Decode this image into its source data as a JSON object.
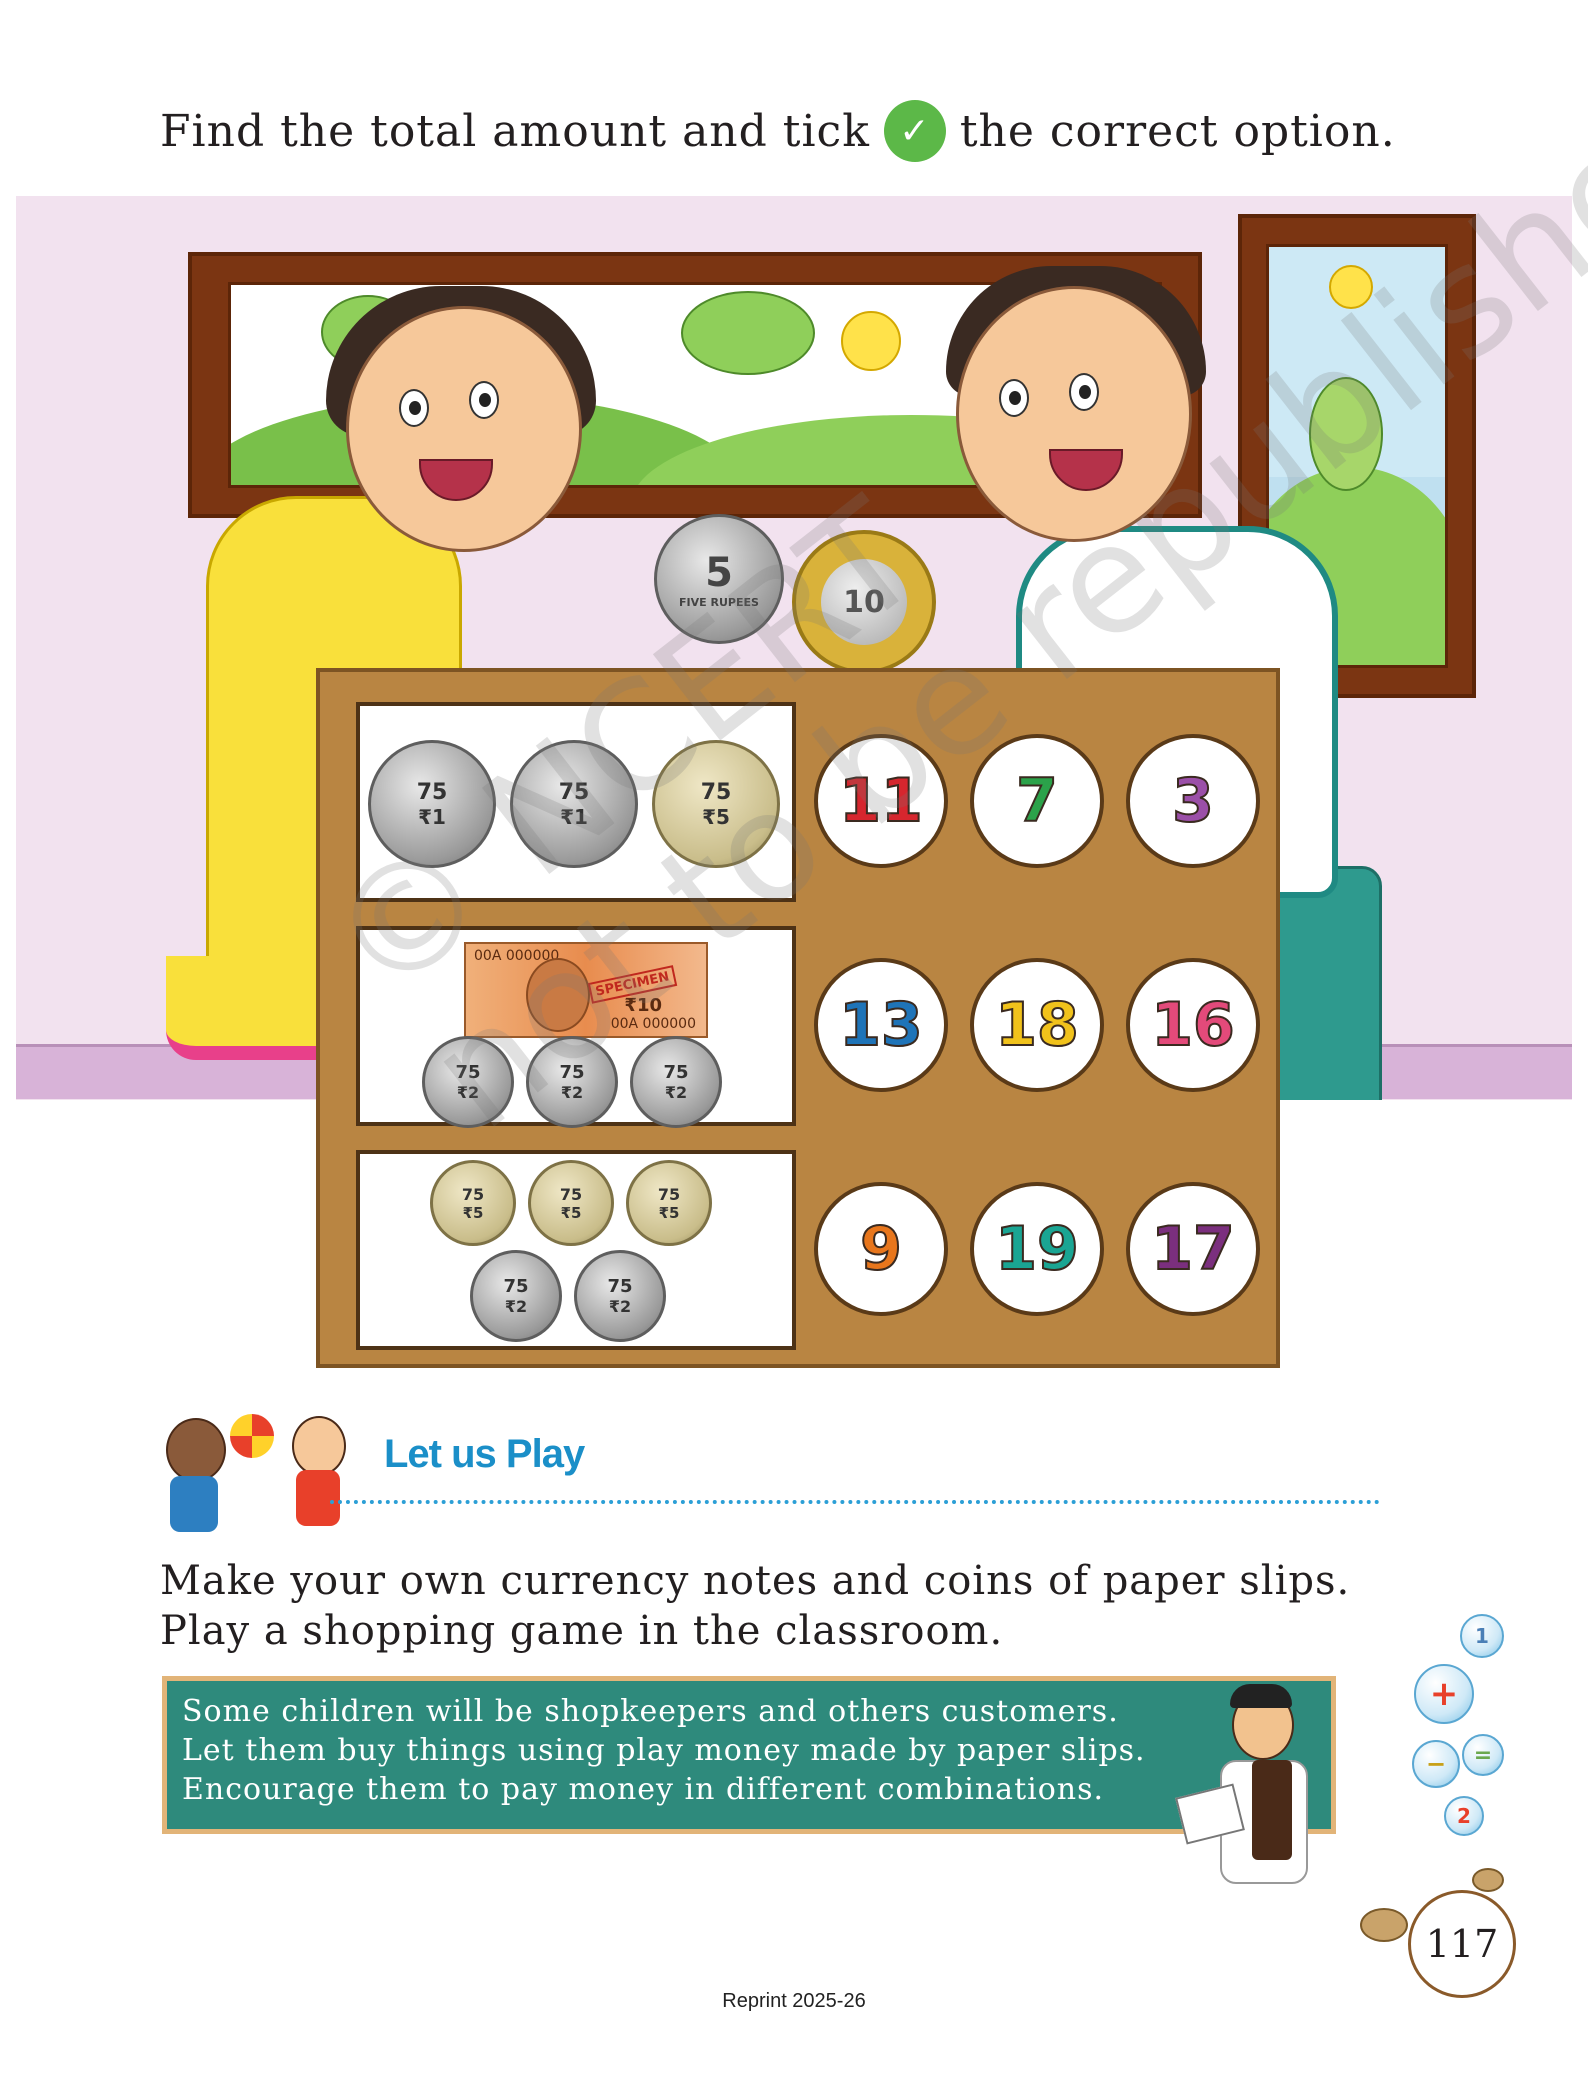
{
  "instruction": {
    "before": "Find the total amount and tick",
    "tick_glyph": "✓",
    "after": "the correct option."
  },
  "scene": {
    "held_coins": [
      {
        "label": "5",
        "sub": "FIVE RUPEES",
        "metal": "silver"
      },
      {
        "label": "10",
        "sub": "",
        "metal": "bimetal"
      }
    ]
  },
  "coin_texts": {
    "commemorative": "75",
    "rupee_1": "₹1",
    "rupee_2": "₹2",
    "rupee_5": "₹5"
  },
  "banknote": {
    "serial_top": "00A 000000",
    "serial_bottom": "00A 000000",
    "value": "₹10",
    "stamp": "SPECIMEN"
  },
  "rows": [
    {
      "coins": [
        "₹1",
        "₹1",
        "₹5"
      ],
      "options": [
        {
          "value": "11",
          "color": "#d6262e"
        },
        {
          "value": "7",
          "color": "#2ba24a"
        },
        {
          "value": "3",
          "color": "#9b4fa8"
        }
      ]
    },
    {
      "coins": [
        "₹10 note",
        "₹2",
        "₹2",
        "₹2"
      ],
      "options": [
        {
          "value": "13",
          "color": "#1f74b8"
        },
        {
          "value": "18",
          "color": "#f1c21b"
        },
        {
          "value": "16",
          "color": "#e34a7a"
        }
      ]
    },
    {
      "coins": [
        "₹5",
        "₹5",
        "₹5",
        "₹2",
        "₹2"
      ],
      "options": [
        {
          "value": "9",
          "color": "#e8761c"
        },
        {
          "value": "19",
          "color": "#1aa593"
        },
        {
          "value": "17",
          "color": "#7b2f7e"
        }
      ]
    }
  ],
  "watermark": {
    "line1": "© NCERT",
    "line2": "not to be republished"
  },
  "section": {
    "title": "Let us Play",
    "text_line1": "Make your own currency notes and coins of paper slips.",
    "text_line2": "Play a shopping game in the classroom."
  },
  "teacher_note": {
    "line1": "Some children will be shopkeepers and others customers.",
    "line2": "Let them buy things using play money made by paper slips.",
    "line3": "Encourage them to pay money in different combinations."
  },
  "bubbles": [
    "1",
    "+",
    "−",
    "=",
    "2"
  ],
  "page_number": "117",
  "footer": "Reprint 2025-26",
  "colors": {
    "tick_green": "#5cb848",
    "heading_blue": "#1b8fc8",
    "board_brown": "#b98542",
    "teacher_box": "#2e8a7c"
  }
}
